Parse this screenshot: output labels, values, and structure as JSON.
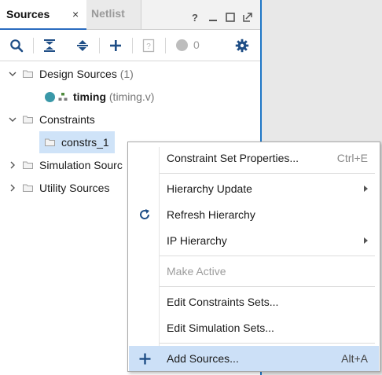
{
  "tabs": {
    "sources": {
      "label": "Sources",
      "close": "×"
    },
    "netlist": {
      "label": "Netlist"
    }
  },
  "window_controls": {
    "help": "?"
  },
  "toolbar": {
    "issue_count": "0",
    "icons": [
      "search-icon",
      "collapse-all-icon",
      "expand-all-icon",
      "add-icon",
      "properties-icon",
      "gear-icon"
    ]
  },
  "tree": {
    "design_sources": {
      "label": "Design Sources",
      "count": "(1)"
    },
    "timing": {
      "name": "timing",
      "file": "(timing.v)"
    },
    "constraints": {
      "label": "Constraints"
    },
    "constrs_1": {
      "label": "constrs_1"
    },
    "simulation_sources": {
      "label": "Simulation Sourc"
    },
    "utility_sources": {
      "label": "Utility Sources"
    }
  },
  "context_menu": {
    "items": [
      {
        "label": "Constraint Set Properties...",
        "shortcut": "Ctrl+E"
      },
      {
        "label": "Hierarchy Update"
      },
      {
        "label": "Refresh Hierarchy"
      },
      {
        "label": "IP Hierarchy"
      },
      {
        "label": "Make Active"
      },
      {
        "label": "Edit Constraints Sets..."
      },
      {
        "label": "Edit Simulation Sets..."
      },
      {
        "label": "Add Sources...",
        "shortcut": "Alt+A"
      }
    ]
  },
  "colors": {
    "accent": "#1e76c6",
    "selection": "#cfe3f8",
    "menu_hover": "#cce0f7",
    "module_dot": "#3a98a8"
  }
}
